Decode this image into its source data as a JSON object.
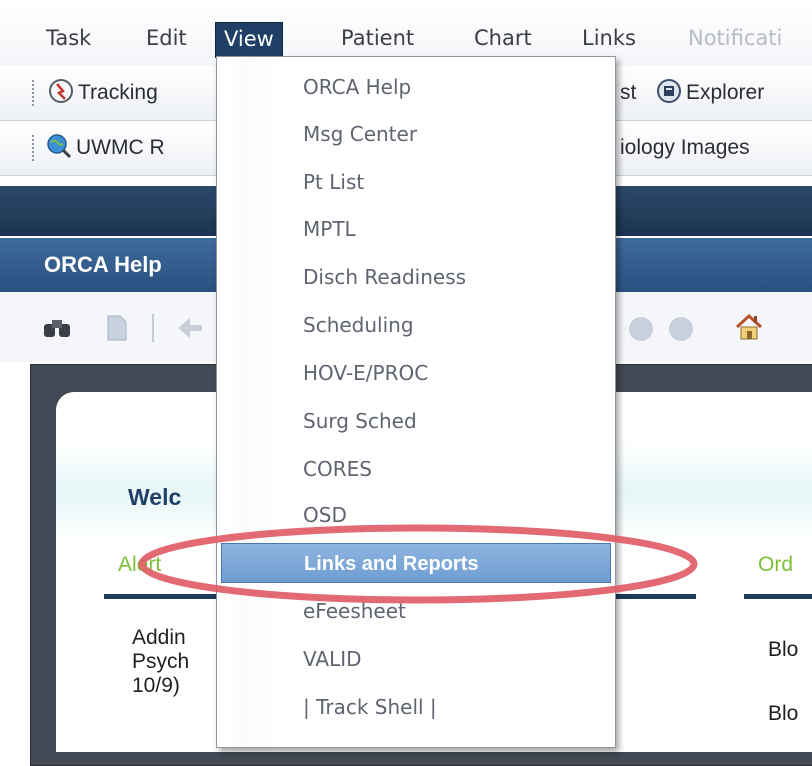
{
  "menubar": {
    "items": [
      {
        "label": "Task"
      },
      {
        "label": "Edit"
      },
      {
        "label": "View"
      },
      {
        "label": "Patient"
      },
      {
        "label": "Chart"
      },
      {
        "label": "Links"
      },
      {
        "label": "Notificati"
      }
    ]
  },
  "toolbar1": {
    "tracking_label": "Tracking",
    "hidden_partial": "st",
    "explorer_label": "Explorer"
  },
  "toolbar2": {
    "uwmc_label": "UWMC R",
    "radiology_label": "iology Images"
  },
  "orca_header": {
    "title": "ORCA Help"
  },
  "content": {
    "welcome": "Welc",
    "section_left": "Alert",
    "section_right": "Ord",
    "body_lines": [
      "Addin",
      "Psych",
      "10/9)"
    ],
    "right_lines": [
      "Blo",
      "Blo"
    ]
  },
  "view_menu": {
    "items": [
      {
        "label": "ORCA Help"
      },
      {
        "label": "Msg Center"
      },
      {
        "label": "Pt List"
      },
      {
        "label": "MPTL"
      },
      {
        "label": "Disch Readiness"
      },
      {
        "label": "Scheduling"
      },
      {
        "label": "HOV-E/PROC"
      },
      {
        "label": "Surg Sched"
      },
      {
        "label": "CORES"
      },
      {
        "label": "OSD"
      },
      {
        "label": "Links and Reports"
      },
      {
        "label": "eFeesheet"
      },
      {
        "label": "VALID"
      },
      {
        "label": "| Track Shell |"
      }
    ],
    "selected_index": 10
  },
  "colors": {
    "menu_active_bg": "#1f3f66",
    "header_blue": "#3f6a9a",
    "highlight_blue": "#7fa8d9",
    "alert_green": "#7cbf38",
    "annotation_red": "#e05a64"
  }
}
